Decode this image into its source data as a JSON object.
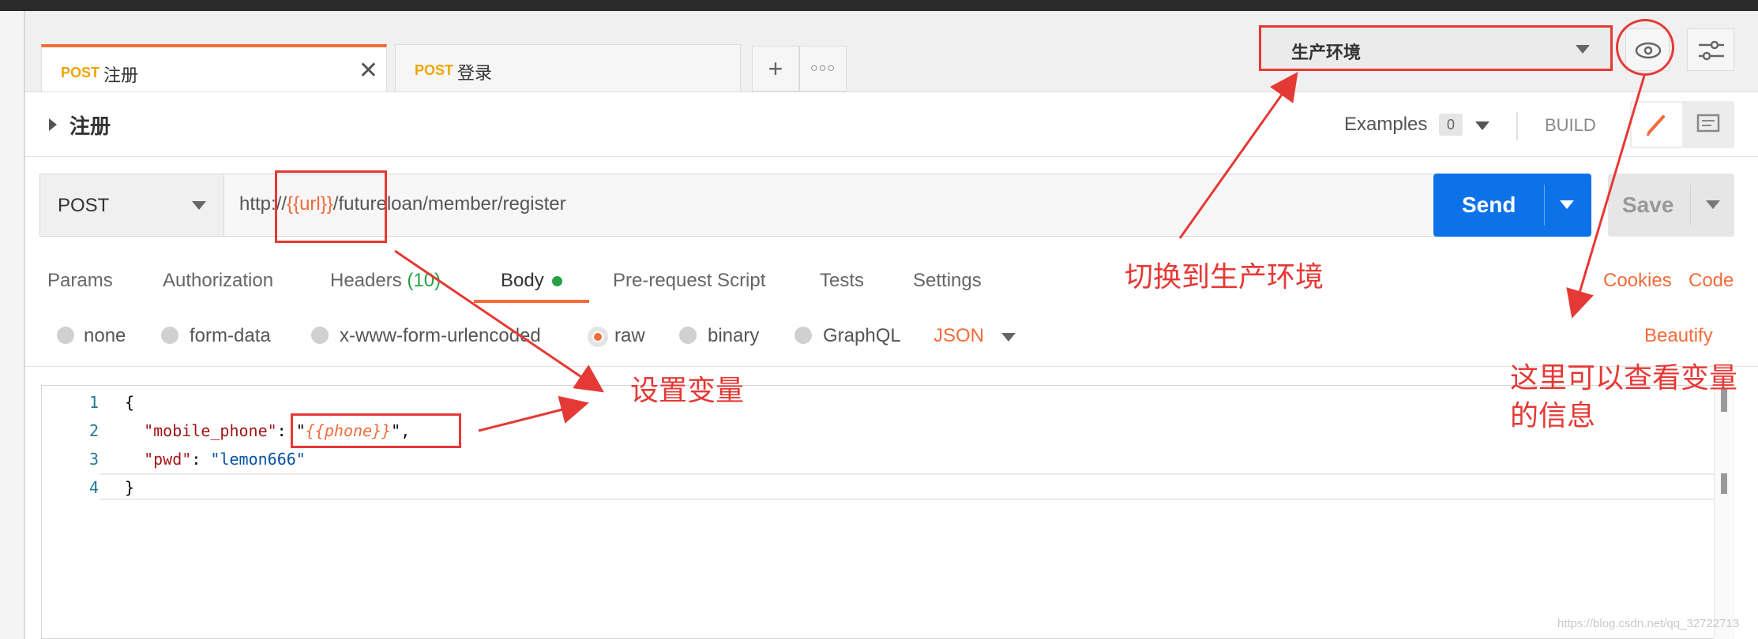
{
  "tabs": [
    {
      "method": "POST",
      "name": "注册"
    },
    {
      "method": "POST",
      "name": "登录"
    }
  ],
  "environment": {
    "selected": "生产环境"
  },
  "request": {
    "name": "注册",
    "examples_label": "Examples",
    "examples_count": "0",
    "build_label": "BUILD",
    "method": "POST",
    "url_prefix": "http://",
    "url_variable": "{{url}}",
    "url_suffix": "/futureloan/member/register",
    "send_label": "Send",
    "save_label": "Save"
  },
  "request_tabs": {
    "params": "Params",
    "authorization": "Authorization",
    "headers": "Headers",
    "headers_count": "(10)",
    "body": "Body",
    "pre_request": "Pre-request Script",
    "tests": "Tests",
    "settings": "Settings",
    "cookies": "Cookies",
    "code": "Code"
  },
  "body_types": {
    "none": "none",
    "form_data": "form-data",
    "urlencoded": "x-www-form-urlencoded",
    "raw": "raw",
    "binary": "binary",
    "graphql": "GraphQL",
    "format": "JSON",
    "beautify": "Beautify"
  },
  "editor": {
    "line_numbers": [
      "1",
      "2",
      "3",
      "4"
    ],
    "open_brace": "{",
    "close_brace": "}",
    "key1": "\"mobile_phone\"",
    "val1": "{{phone}}",
    "key2": "\"pwd\"",
    "val2": "\"lemon666\""
  },
  "annotations": {
    "switch_env": "切换到生产环境",
    "set_variable": "设置变量",
    "view_variable_line1": "这里可以查看变量",
    "view_variable_line2": "的信息"
  },
  "watermark": "https://blog.csdn.net/qq_32722713",
  "colors": {
    "accent": "#f26b3a",
    "send": "#0d72e8",
    "annotation": "#e53935",
    "method": "#f0a500"
  }
}
